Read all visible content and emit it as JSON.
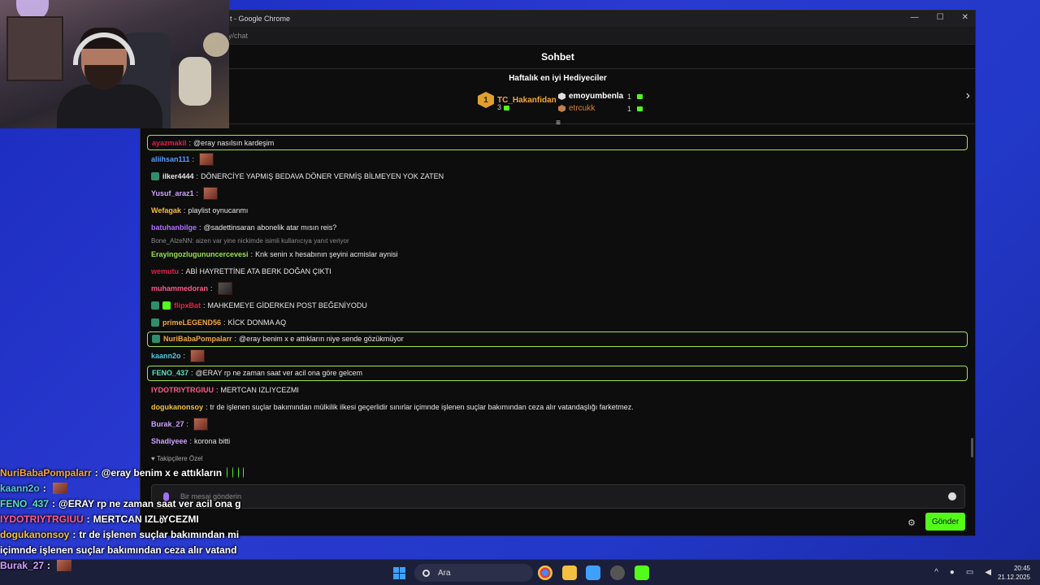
{
  "window": {
    "title": "t - Google Chrome",
    "url": "y/chat",
    "minimize": "—",
    "maximize": "☐",
    "close": "✕"
  },
  "chat": {
    "header": "Sohbet",
    "top_gifters": {
      "title": "Haftalık en iyi Hediyeciler",
      "first": {
        "rank": "1",
        "name": "TC_Hakanfidan",
        "count": "3"
      },
      "second": {
        "name": "emoyumbenla",
        "count": "1"
      },
      "third": {
        "name": "etrcukk",
        "count": "1"
      }
    },
    "messages": [
      {
        "user": "ayazmakil",
        "text": "@eray nasılsın kardeşim",
        "user_color": "#e0204a",
        "highlight": true
      },
      {
        "user": "aliihsan111",
        "text": "",
        "user_color": "#5a9cff",
        "emote": true
      },
      {
        "user": "ilker4444",
        "text": "DÖNERCİYE YAPMIŞ BEDAVA DÖNER VERMİŞ BİLMEYEN YOK ZATEN",
        "user_color": "#e8e8e8",
        "badge": true
      },
      {
        "user": "Yusuf_araz1",
        "text": "",
        "user_color": "#d0a0ff",
        "emote": true
      },
      {
        "user": "Wefagak",
        "text": "playlist oynucanmı",
        "user_color": "#f3c040"
      },
      {
        "user": "batuhanbilge",
        "text": "@sadettinsaran abonelik atar mısın reis?",
        "user_color": "#b070ff"
      },
      {
        "reply": "Bone_AlzeNN: aizen var yine nickimde isimli kullanıcıya yanıt veriyor"
      },
      {
        "user": "Erayingozlugununcercevesi",
        "text": "Knk senin x hesabının şeyini acmislar aynisi",
        "user_color": "#9ae34a"
      },
      {
        "user": "wemutu",
        "text": "ABİ HAYRETTİNE ATA BERK DOĞAN ÇIKTI",
        "user_color": "#e0204a"
      },
      {
        "user": "muhammedoran",
        "text": "",
        "user_color": "#ff5a8a",
        "emote": true,
        "emote_dark": true
      },
      {
        "user": "flipxBat",
        "text": "MAHKEMEYE GİDERKEN POST BEĞENİYODU",
        "user_color": "#e0204a",
        "badge": true,
        "badge2": true
      },
      {
        "user": "primeLEGEND56",
        "text": "KİCK DONMA AQ",
        "user_color": "#f3a83b",
        "badge": true
      },
      {
        "user": "NuriBabaPompalarr",
        "text": "@eray benim x e attıkların niye sende gözükmüyor",
        "user_color": "#f3a83b",
        "highlight": true,
        "badge": true
      },
      {
        "user": "kaann2o",
        "text": "",
        "user_color": "#5ac8e0",
        "emote": true
      },
      {
        "user": "FENO_437",
        "text": "@ERAY rp ne zaman saat ver acil ona göre gelcem",
        "user_color": "#5ae0c0",
        "highlight": true
      },
      {
        "user": "IYDOTRIYTRGIUU",
        "text": "MERTCAN IZLIYCEZMI",
        "user_color": "#ff5a8a"
      },
      {
        "user": "dogukanonsoy",
        "text": "tr de işlenen suçlar bakımından mülkilik ilkesi geçerlidir sınırlar içimnde işlenen suçlar bakımından ceza alır vatandaşlığı farketmez.",
        "user_color": "#f3c040"
      },
      {
        "user": "Burak_27",
        "text": "",
        "user_color": "#d0a0ff",
        "emote": true
      },
      {
        "user": "Shadiyeee",
        "text": "korona bitti",
        "user_color": "#d0a0ff"
      }
    ],
    "follow_note": "♥ Takipçilere Özel",
    "input_placeholder": "Bir mesaj gönderin",
    "send_label": "Gönder"
  },
  "overlay": {
    "lines": [
      {
        "user": "NuriBabaPompalarr",
        "sep": ":",
        "text": "@eray benim x e attıkların",
        "user_color": "#f3a83b"
      },
      {
        "user": "kaann2o",
        "sep": ":",
        "text": "",
        "user_color": "#5ac8e0"
      },
      {
        "user": "FENO_437",
        "sep": ":",
        "text": "@ERAY rp ne zaman saat ver acil ona g",
        "user_color": "#5ae0c0"
      },
      {
        "user": "IYDOTRIYTRGIUU",
        "sep": ":",
        "text": "MERTCAN IZLIYCEZMI",
        "user_color": "#ff5a8a"
      },
      {
        "user": "dogukanonsoy",
        "sep": ":",
        "text": "tr de işlenen suçlar bakımından mi",
        "user_color": "#f3c040"
      },
      {
        "user": "",
        "sep": "",
        "text": "içimnde işlenen suçlar bakımından ceza alır vatand",
        "user_color": "#fff"
      },
      {
        "user": "Burak_27",
        "sep": ":",
        "text": "",
        "user_color": "#d0a0ff"
      }
    ],
    "viewer_count": "0"
  },
  "taskbar": {
    "search_placeholder": "Ara",
    "time": "20:45",
    "date": "21.12.2025"
  }
}
